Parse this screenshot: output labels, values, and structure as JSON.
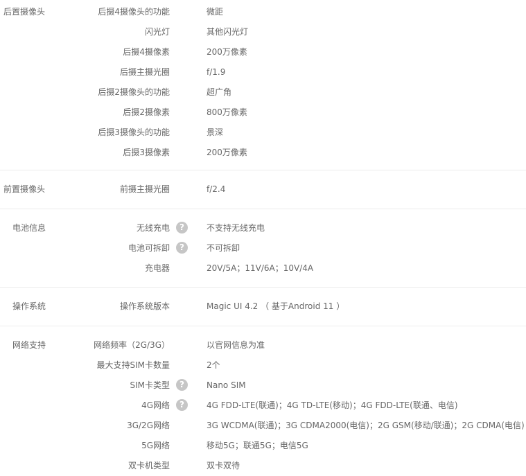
{
  "help_glyph": "?",
  "sections": {
    "rear_camera": {
      "title": "后置摄像头",
      "rows": [
        {
          "label": "后摄4摄像头的功能",
          "value": "微距"
        },
        {
          "label": "闪光灯",
          "value": "其他闪光灯"
        },
        {
          "label": "后摄4摄像素",
          "value": "200万像素"
        },
        {
          "label": "后摄主摄光圈",
          "value": "f/1.9"
        },
        {
          "label": "后摄2摄像头的功能",
          "value": "超广角"
        },
        {
          "label": "后摄2摄像素",
          "value": "800万像素"
        },
        {
          "label": "后摄3摄像头的功能",
          "value": "景深"
        },
        {
          "label": "后摄3摄像素",
          "value": "200万像素"
        }
      ]
    },
    "front_camera": {
      "title": "前置摄像头",
      "rows": [
        {
          "label": "前摄主摄光圈",
          "value": "f/2.4"
        }
      ]
    },
    "battery": {
      "title": "电池信息",
      "rows": [
        {
          "label": "无线充电",
          "value": "不支持无线充电"
        },
        {
          "label": "电池可拆卸",
          "value": "不可拆卸"
        },
        {
          "label": "充电器",
          "value": "20V/5A；11V/6A；10V/4A"
        }
      ]
    },
    "os": {
      "title": "操作系统",
      "rows": [
        {
          "label": "操作系统版本",
          "value": "Magic UI 4.2 （ 基于Android 11 ）"
        }
      ]
    },
    "network": {
      "title": "网络支持",
      "rows": [
        {
          "label": "网络频率（2G/3G）",
          "value": "以官网信息为准"
        },
        {
          "label": "最大支持SIM卡数量",
          "value": "2个"
        },
        {
          "label": "SIM卡类型",
          "value": "Nano SIM"
        },
        {
          "label": "4G网络",
          "value": "4G FDD-LTE(联通)；4G TD-LTE(移动)；4G FDD-LTE(联通、电信)"
        },
        {
          "label": "3G/2G网络",
          "value": "3G WCDMA(联通)；3G CDMA2000(电信)；2G GSM(移动/联通)；2G CDMA(电信)"
        },
        {
          "label": "5G网络",
          "value": "移动5G；联通5G；电信5G"
        },
        {
          "label": "双卡机类型",
          "value": "双卡双待"
        }
      ]
    }
  }
}
